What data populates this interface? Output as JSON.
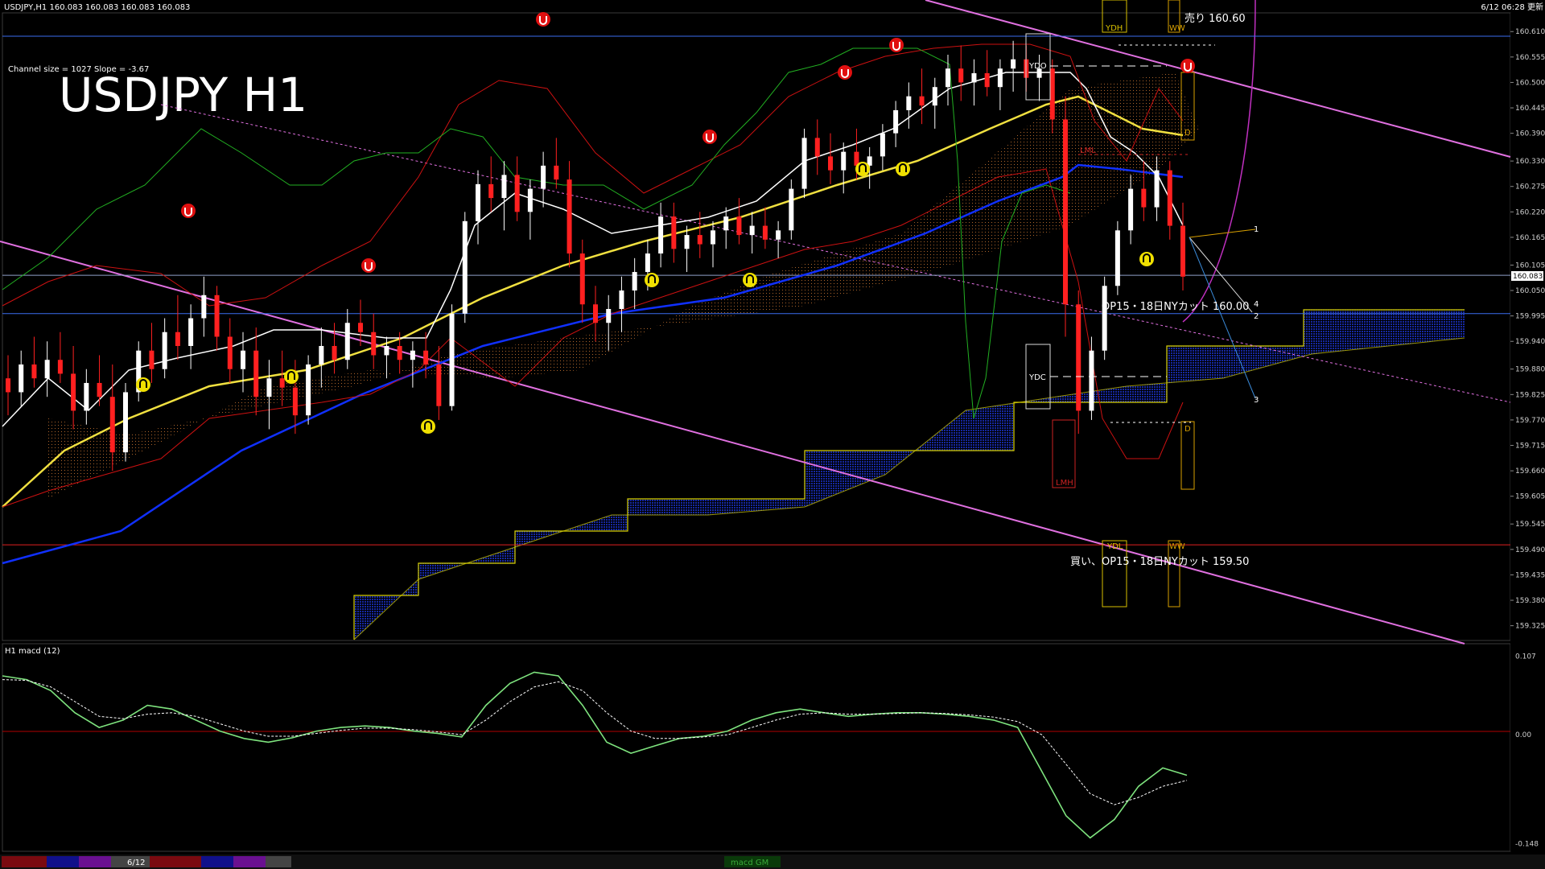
{
  "window": {
    "chart_header": "USDJPY,H1  160.083 160.083 160.083 160.083",
    "datetime_label": "6/12 06:28 更新",
    "channel_info": "Channel size = 1027 Slope = -3.67",
    "big_title": "USDJPY H1",
    "macd_header": "H1  macd (12)"
  },
  "annotations": {
    "sell_label": "売り 160.60",
    "op_sell_label": "OP15・18日NYカット 160.00",
    "buy_label": "買い、OP15・18日NYカット 159.50",
    "ydh": "YDH",
    "ydo": "YDO",
    "ydc": "YDC",
    "ydl": "YDL",
    "lmh": "LMH",
    "lml": "LML",
    "ww_top": "WW",
    "ww_bottom": "WW",
    "d_top": "D",
    "d_bottom": "D",
    "proj1": "1",
    "proj2": "2",
    "proj3": "3",
    "proj4": "4"
  },
  "bottom_tabs": {
    "date_tab": "6/12",
    "macd_tab": "macd GM"
  },
  "chart_data": [
    {
      "type": "candlestick",
      "title": "USDJPY H1",
      "symbol": "USDJPY",
      "timeframe": "H1",
      "y_ticks": [
        "160.610",
        "160.555",
        "160.500",
        "160.445",
        "160.390",
        "160.330",
        "160.275",
        "160.220",
        "160.165",
        "160.105",
        "160.050",
        "159.995",
        "159.940",
        "159.880",
        "159.825",
        "159.770",
        "159.715",
        "159.660",
        "159.605",
        "159.545",
        "159.490",
        "159.435",
        "159.380",
        "159.325"
      ],
      "ylim": [
        159.3,
        160.64
      ],
      "current_price": "160.083",
      "horizontal_levels": [
        {
          "value": 160.6,
          "color": "#3a6df0"
        },
        {
          "value": 160.0,
          "color": "#3a6df0"
        },
        {
          "value": 159.5,
          "color": "#e02020"
        },
        {
          "value": 160.083,
          "color": "#8fa0c8"
        }
      ],
      "candles": [
        [
          159.86,
          159.91,
          159.78,
          159.83
        ],
        [
          159.83,
          159.92,
          159.8,
          159.89
        ],
        [
          159.89,
          159.95,
          159.84,
          159.86
        ],
        [
          159.86,
          159.94,
          159.82,
          159.9
        ],
        [
          159.9,
          159.96,
          159.85,
          159.87
        ],
        [
          159.87,
          159.93,
          159.75,
          159.79
        ],
        [
          159.79,
          159.88,
          159.76,
          159.85
        ],
        [
          159.85,
          159.91,
          159.8,
          159.82
        ],
        [
          159.82,
          159.89,
          159.66,
          159.7
        ],
        [
          159.7,
          159.85,
          159.68,
          159.83
        ],
        [
          159.83,
          159.94,
          159.81,
          159.92
        ],
        [
          159.92,
          159.98,
          159.85,
          159.88
        ],
        [
          159.88,
          159.99,
          159.86,
          159.96
        ],
        [
          159.96,
          160.04,
          159.9,
          159.93
        ],
        [
          159.93,
          160.02,
          159.88,
          159.99
        ],
        [
          159.99,
          160.08,
          159.95,
          160.04
        ],
        [
          160.04,
          160.06,
          159.92,
          159.95
        ],
        [
          159.95,
          159.99,
          159.85,
          159.88
        ],
        [
          159.88,
          159.96,
          159.83,
          159.92
        ],
        [
          159.92,
          159.97,
          159.78,
          159.82
        ],
        [
          159.82,
          159.9,
          159.75,
          159.86
        ],
        [
          159.86,
          159.92,
          159.8,
          159.84
        ],
        [
          159.84,
          159.9,
          159.74,
          159.78
        ],
        [
          159.78,
          159.91,
          159.76,
          159.89
        ],
        [
          159.89,
          159.97,
          159.84,
          159.93
        ],
        [
          159.93,
          159.98,
          159.87,
          159.9
        ],
        [
          159.9,
          160.01,
          159.88,
          159.98
        ],
        [
          159.98,
          160.03,
          159.93,
          159.96
        ],
        [
          159.96,
          160.0,
          159.88,
          159.91
        ],
        [
          159.91,
          159.95,
          159.86,
          159.93
        ],
        [
          159.93,
          159.96,
          159.87,
          159.9
        ],
        [
          159.9,
          159.94,
          159.84,
          159.92
        ],
        [
          159.92,
          159.96,
          159.86,
          159.89
        ],
        [
          159.89,
          159.93,
          159.77,
          159.8
        ],
        [
          159.8,
          160.02,
          159.79,
          160.0
        ],
        [
          160.0,
          160.22,
          159.98,
          160.2
        ],
        [
          160.2,
          160.31,
          160.15,
          160.28
        ],
        [
          160.28,
          160.34,
          160.22,
          160.25
        ],
        [
          160.25,
          160.33,
          160.18,
          160.3
        ],
        [
          160.3,
          160.34,
          160.2,
          160.22
        ],
        [
          160.22,
          160.29,
          160.16,
          160.27
        ],
        [
          160.27,
          160.35,
          160.23,
          160.32
        ],
        [
          160.32,
          160.38,
          160.27,
          160.29
        ],
        [
          160.29,
          160.33,
          160.1,
          160.13
        ],
        [
          160.13,
          160.16,
          159.98,
          160.02
        ],
        [
          160.02,
          160.06,
          159.94,
          159.98
        ],
        [
          159.98,
          160.04,
          159.92,
          160.01
        ],
        [
          160.01,
          160.08,
          159.96,
          160.05
        ],
        [
          160.05,
          160.12,
          160.01,
          160.09
        ],
        [
          160.09,
          160.16,
          160.05,
          160.13
        ],
        [
          160.13,
          160.24,
          160.1,
          160.21
        ],
        [
          160.21,
          160.24,
          160.11,
          160.14
        ],
        [
          160.14,
          160.19,
          160.09,
          160.17
        ],
        [
          160.17,
          160.22,
          160.12,
          160.15
        ],
        [
          160.15,
          160.2,
          160.1,
          160.18
        ],
        [
          160.18,
          160.23,
          160.14,
          160.21
        ],
        [
          160.21,
          160.25,
          160.15,
          160.17
        ],
        [
          160.17,
          160.22,
          160.13,
          160.19
        ],
        [
          160.19,
          160.23,
          160.14,
          160.16
        ],
        [
          160.16,
          160.2,
          160.12,
          160.18
        ],
        [
          160.18,
          160.29,
          160.16,
          160.27
        ],
        [
          160.27,
          160.4,
          160.25,
          160.38
        ],
        [
          160.38,
          160.42,
          160.3,
          160.34
        ],
        [
          160.34,
          160.39,
          160.28,
          160.31
        ],
        [
          160.31,
          160.37,
          160.26,
          160.35
        ],
        [
          160.35,
          160.4,
          160.29,
          160.32
        ],
        [
          160.32,
          160.36,
          160.27,
          160.34
        ],
        [
          160.34,
          160.41,
          160.31,
          160.39
        ],
        [
          160.39,
          160.46,
          160.36,
          160.44
        ],
        [
          160.44,
          160.5,
          160.4,
          160.47
        ],
        [
          160.47,
          160.53,
          160.41,
          160.45
        ],
        [
          160.45,
          160.51,
          160.4,
          160.49
        ],
        [
          160.49,
          160.56,
          160.45,
          160.53
        ],
        [
          160.53,
          160.58,
          160.46,
          160.5
        ],
        [
          160.5,
          160.55,
          160.45,
          160.52
        ],
        [
          160.52,
          160.57,
          160.47,
          160.49
        ],
        [
          160.49,
          160.55,
          160.44,
          160.53
        ],
        [
          160.53,
          160.59,
          160.48,
          160.55
        ],
        [
          160.55,
          160.58,
          160.48,
          160.51
        ],
        [
          160.51,
          160.56,
          160.46,
          160.53
        ],
        [
          160.53,
          160.55,
          160.39,
          160.42
        ],
        [
          160.42,
          160.47,
          159.95,
          160.02
        ],
        [
          160.02,
          160.05,
          159.74,
          159.79
        ],
        [
          159.79,
          159.95,
          159.77,
          159.92
        ],
        [
          159.92,
          160.08,
          159.9,
          160.06
        ],
        [
          160.06,
          160.2,
          160.04,
          160.18
        ],
        [
          160.18,
          160.3,
          160.15,
          160.27
        ],
        [
          160.27,
          160.33,
          160.2,
          160.23
        ],
        [
          160.23,
          160.34,
          160.2,
          160.31
        ],
        [
          160.31,
          160.33,
          160.16,
          160.19
        ],
        [
          160.19,
          160.24,
          160.05,
          160.08
        ]
      ]
    },
    {
      "type": "line",
      "title": "macd (12)",
      "y_ticks": [
        "0.107",
        "0.00",
        "-0.148"
      ],
      "ylim": [
        -0.155,
        0.115
      ],
      "series": [
        {
          "color": "#7ee37e",
          "values": [
            0.08,
            0.075,
            0.06,
            0.03,
            0.01,
            0.02,
            0.04,
            0.035,
            0.02,
            0.005,
            -0.005,
            -0.01,
            -0.004,
            0.005,
            0.01,
            0.012,
            0.01,
            0.005,
            0.002,
            -0.003,
            0.04,
            0.07,
            0.085,
            0.08,
            0.04,
            -0.01,
            -0.025,
            -0.015,
            -0.005,
            -0.002,
            0.005,
            0.02,
            0.03,
            0.035,
            0.03,
            0.025,
            0.028,
            0.03,
            0.03,
            0.028,
            0.025,
            0.02,
            0.01,
            -0.05,
            -0.11,
            -0.14,
            -0.115,
            -0.07,
            -0.045,
            -0.055
          ]
        },
        {
          "color": "#ffffff",
          "values": [
            0.075,
            0.074,
            0.065,
            0.045,
            0.025,
            0.022,
            0.028,
            0.03,
            0.025,
            0.015,
            0.005,
            -0.002,
            -0.002,
            0.002,
            0.006,
            0.009,
            0.009,
            0.007,
            0.004,
            0.0,
            0.02,
            0.045,
            0.065,
            0.072,
            0.06,
            0.03,
            0.005,
            -0.005,
            -0.005,
            -0.003,
            0.0,
            0.01,
            0.02,
            0.028,
            0.03,
            0.028,
            0.028,
            0.029,
            0.03,
            0.029,
            0.027,
            0.024,
            0.018,
            0.0,
            -0.04,
            -0.08,
            -0.095,
            -0.085,
            -0.07,
            -0.062
          ]
        }
      ]
    }
  ]
}
